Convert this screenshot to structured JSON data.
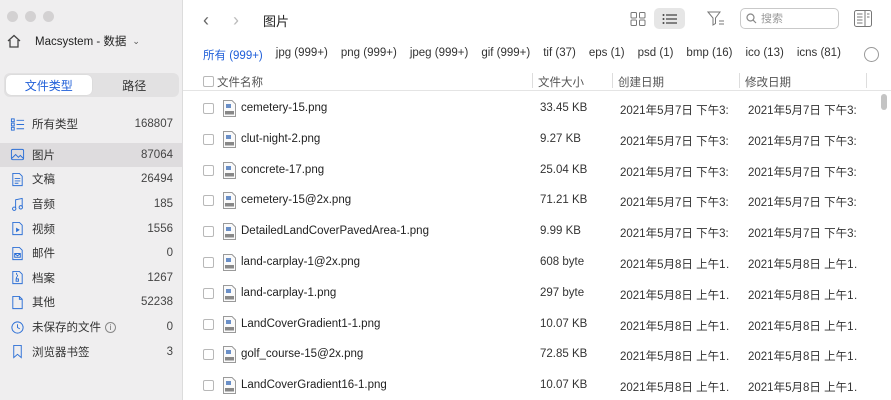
{
  "sidebar": {
    "account_name": "Macsystem - 数据",
    "segments": [
      {
        "label": "文件类型",
        "active": true
      },
      {
        "label": "路径",
        "active": false
      }
    ],
    "categories": [
      {
        "label": "所有类型",
        "count": "168807",
        "icon": "grid-list-icon"
      },
      {
        "label": "图片",
        "count": "87064",
        "icon": "image-icon",
        "selected": true
      },
      {
        "label": "文稿",
        "count": "26494",
        "icon": "document-icon"
      },
      {
        "label": "音频",
        "count": "185",
        "icon": "music-note-icon"
      },
      {
        "label": "视频",
        "count": "1556",
        "icon": "video-icon"
      },
      {
        "label": "邮件",
        "count": "0",
        "icon": "mail-icon"
      },
      {
        "label": "档案",
        "count": "1267",
        "icon": "archive-icon"
      },
      {
        "label": "其他",
        "count": "52238",
        "icon": "other-file-icon"
      },
      {
        "label": "未保存的文件",
        "count": "0",
        "icon": "unsaved-file-icon",
        "info": "i"
      },
      {
        "label": "浏览器书签",
        "count": "3",
        "icon": "bookmark-icon"
      }
    ]
  },
  "toolbar": {
    "title": "图片",
    "search_placeholder": "搜索"
  },
  "tabs": [
    {
      "label": "所有 (999+)",
      "active": true
    },
    {
      "label": "jpg (999+)"
    },
    {
      "label": "png (999+)"
    },
    {
      "label": "jpeg (999+)"
    },
    {
      "label": "gif (999+)"
    },
    {
      "label": "tif (37)"
    },
    {
      "label": "eps (1)"
    },
    {
      "label": "psd (1)"
    },
    {
      "label": "bmp (16)"
    },
    {
      "label": "ico (13)"
    },
    {
      "label": "icns (81)"
    }
  ],
  "table": {
    "headers": {
      "name": "文件名称",
      "size": "文件大小",
      "created": "创建日期",
      "modified": "修改日期"
    },
    "rows": [
      {
        "name": "cemetery-15.png",
        "size": "33.45 KB",
        "created": "2021年5月7日 下午3:…",
        "modified": "2021年5月7日 下午3:…"
      },
      {
        "name": "clut-night-2.png",
        "size": "9.27 KB",
        "created": "2021年5月7日 下午3:…",
        "modified": "2021年5月7日 下午3:…"
      },
      {
        "name": "concrete-17.png",
        "size": "25.04 KB",
        "created": "2021年5月7日 下午3:…",
        "modified": "2021年5月7日 下午3:…"
      },
      {
        "name": "cemetery-15@2x.png",
        "size": "71.21 KB",
        "created": "2021年5月7日 下午3:…",
        "modified": "2021年5月7日 下午3:…"
      },
      {
        "name": "DetailedLandCoverPavedArea-1.png",
        "size": "9.99 KB",
        "created": "2021年5月7日 下午3:…",
        "modified": "2021年5月7日 下午3:…"
      },
      {
        "name": "land-carplay-1@2x.png",
        "size": "608 byte",
        "created": "2021年5月8日 上午1…",
        "modified": "2021年5月8日 上午1…"
      },
      {
        "name": "land-carplay-1.png",
        "size": "297 byte",
        "created": "2021年5月8日 上午1…",
        "modified": "2021年5月8日 上午1…"
      },
      {
        "name": "LandCoverGradient1-1.png",
        "size": "10.07 KB",
        "created": "2021年5月8日 上午1…",
        "modified": "2021年5月8日 上午1…"
      },
      {
        "name": "golf_course-15@2x.png",
        "size": "72.85 KB",
        "created": "2021年5月8日 上午1…",
        "modified": "2021年5月8日 上午1…"
      },
      {
        "name": "LandCoverGradient16-1.png",
        "size": "10.07 KB",
        "created": "2021年5月8日 上午1…",
        "modified": "2021年5月8日 上午1…"
      }
    ]
  },
  "colors": {
    "accent": "#2160d9",
    "sidebar_bg": "#efeeef",
    "icon_blue": "#2b6fd6"
  }
}
